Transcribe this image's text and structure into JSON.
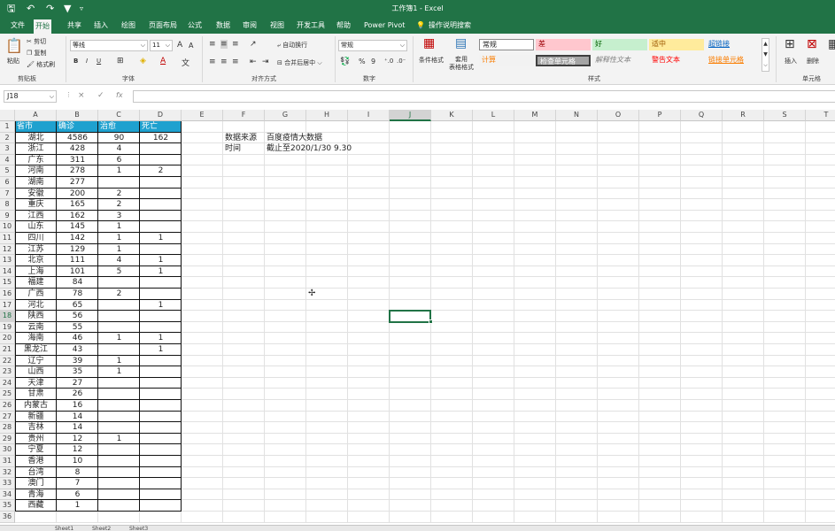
{
  "window": {
    "title": "工作簿1  -  Excel"
  },
  "quick_access": {
    "save_icon": "save-icon",
    "undo_icon": "undo-icon",
    "redo_icon": "redo-icon",
    "filter_icon": "filter-icon"
  },
  "tabs": [
    "文件",
    "开始",
    "插入",
    "插入",
    "绘图",
    "页面布局",
    "公式",
    "数据",
    "审阅",
    "视图",
    "开发工具",
    "帮助",
    "Power Pivot",
    "操作说明搜索"
  ],
  "ribbon_tabs": [
    {
      "label": "文件",
      "active": false
    },
    {
      "label": "开始",
      "active": true
    },
    {
      "label": "共享",
      "active": false
    },
    {
      "label": "插入",
      "active": false
    },
    {
      "label": "绘图",
      "active": false
    },
    {
      "label": "页面布局",
      "active": false
    },
    {
      "label": "公式",
      "active": false
    },
    {
      "label": "数据",
      "active": false
    },
    {
      "label": "审阅",
      "active": false
    },
    {
      "label": "视图",
      "active": false
    },
    {
      "label": "开发工具",
      "active": false
    },
    {
      "label": "帮助",
      "active": false
    },
    {
      "label": "Power Pivot",
      "active": false
    },
    {
      "label": "操作说明搜索",
      "active": false
    }
  ],
  "ribbon": {
    "clipboard": {
      "paste": "粘贴",
      "cut": "剪切",
      "copy": "复制",
      "format_painter": "格式刷",
      "label": "剪贴板"
    },
    "font": {
      "name": "等线",
      "size": "11",
      "grow": "A",
      "shrink": "A",
      "bold": "B",
      "italic": "I",
      "underline": "U",
      "label": "字体"
    },
    "alignment": {
      "wrap": "自动换行",
      "merge": "合并后居中",
      "label": "对齐方式"
    },
    "number": {
      "format": "常规",
      "percent": "%",
      "comma": "9",
      "label": "数字"
    },
    "styles": {
      "cond_format": "条件格式",
      "table_format": "套用\n表格格式",
      "cells": [
        {
          "label": "常规",
          "bg": "#ffffff",
          "fg": "#222222"
        },
        {
          "label": "差",
          "bg": "#ffc7ce",
          "fg": "#9c0006"
        },
        {
          "label": "好",
          "bg": "#c6efce",
          "fg": "#006100"
        },
        {
          "label": "适中",
          "bg": "#ffeb9c",
          "fg": "#9c5700"
        },
        {
          "label": "超链接",
          "bg": "#f3f3f3",
          "fg": "#0563c1"
        },
        {
          "label": "计算",
          "bg": "#f2f2f2",
          "fg": "#fa7d00"
        },
        {
          "label": "检查单元格",
          "bg": "#a5a5a5",
          "fg": "#ffffff"
        },
        {
          "label": "解释性文本",
          "bg": "#f3f3f3",
          "fg": "#7f7f7f"
        },
        {
          "label": "警告文本",
          "bg": "#f3f3f3",
          "fg": "#ff0000"
        },
        {
          "label": "链接单元格",
          "bg": "#f3f3f3",
          "fg": "#fa7d00"
        }
      ],
      "label": "样式"
    },
    "cells_group": {
      "insert": "插入",
      "delete": "删除",
      "label": "单元格"
    }
  },
  "formula_bar": {
    "name_box": "J18",
    "cancel": "×",
    "enter": "✓",
    "fx": "fx",
    "value": ""
  },
  "columns": [
    "A",
    "B",
    "C",
    "D",
    "E",
    "F",
    "G",
    "H",
    "I",
    "J",
    "K",
    "L",
    "M",
    "N",
    "O",
    "P",
    "Q",
    "R",
    "S",
    "T"
  ],
  "selected_column": "J",
  "selected_row": 18,
  "table": {
    "headers": [
      "省市",
      "确诊",
      "治愈",
      "死亡"
    ],
    "rows": [
      [
        "湖北",
        "4586",
        "90",
        "162"
      ],
      [
        "浙江",
        "428",
        "4",
        ""
      ],
      [
        "广东",
        "311",
        "6",
        ""
      ],
      [
        "河南",
        "278",
        "1",
        "2"
      ],
      [
        "湖南",
        "277",
        "",
        ""
      ],
      [
        "安徽",
        "200",
        "2",
        ""
      ],
      [
        "重庆",
        "165",
        "2",
        ""
      ],
      [
        "江西",
        "162",
        "3",
        ""
      ],
      [
        "山东",
        "145",
        "1",
        ""
      ],
      [
        "四川",
        "142",
        "1",
        "1"
      ],
      [
        "江苏",
        "129",
        "1",
        ""
      ],
      [
        "北京",
        "111",
        "4",
        "1"
      ],
      [
        "上海",
        "101",
        "5",
        "1"
      ],
      [
        "福建",
        "84",
        "",
        ""
      ],
      [
        "广西",
        "78",
        "2",
        ""
      ],
      [
        "河北",
        "65",
        "",
        "1"
      ],
      [
        "陕西",
        "56",
        "",
        ""
      ],
      [
        "云南",
        "55",
        "",
        ""
      ],
      [
        "海南",
        "46",
        "1",
        "1"
      ],
      [
        "黑龙江",
        "43",
        "",
        "1"
      ],
      [
        "辽宁",
        "39",
        "1",
        ""
      ],
      [
        "山西",
        "35",
        "1",
        ""
      ],
      [
        "天津",
        "27",
        "",
        ""
      ],
      [
        "甘肃",
        "26",
        "",
        ""
      ],
      [
        "内蒙古",
        "16",
        "",
        ""
      ],
      [
        "新疆",
        "14",
        "",
        ""
      ],
      [
        "吉林",
        "14",
        "",
        ""
      ],
      [
        "贵州",
        "12",
        "1",
        ""
      ],
      [
        "宁夏",
        "12",
        "",
        ""
      ],
      [
        "香港",
        "10",
        "",
        ""
      ],
      [
        "台湾",
        "8",
        "",
        ""
      ],
      [
        "澳门",
        "7",
        "",
        ""
      ],
      [
        "青海",
        "6",
        "",
        ""
      ],
      [
        "西藏",
        "1",
        "",
        ""
      ]
    ]
  },
  "notes": [
    {
      "label": "数据来源",
      "value": "百度疫情大数据"
    },
    {
      "label": "时间",
      "value": "截止至2020/1/30  9.30"
    }
  ],
  "sheet_tabs": [
    "Sheet1",
    "Sheet2",
    "Sheet3"
  ]
}
